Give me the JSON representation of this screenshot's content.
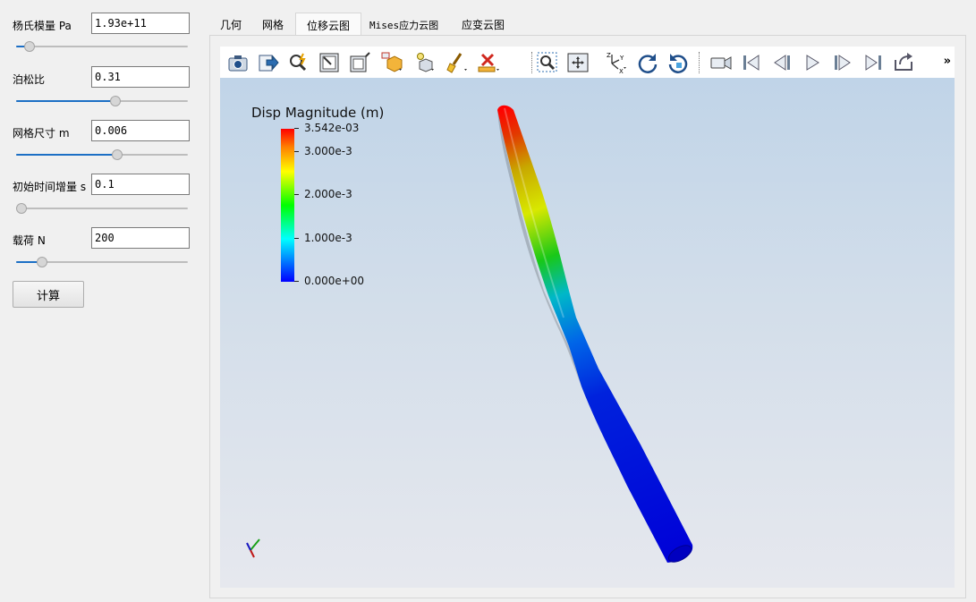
{
  "params": [
    {
      "label": "杨氏模量 Pa",
      "value": "1.93e+11",
      "slider": 0.08
    },
    {
      "label": "泊松比",
      "value": "0.31",
      "slider": 0.58
    },
    {
      "label": "网格尺寸 m",
      "value": "0.006",
      "slider": 0.59
    },
    {
      "label": "初始时间增量 s",
      "value": "0.1",
      "slider": 0.0
    },
    {
      "label": "载荷 N",
      "value": "200",
      "slider": 0.15
    }
  ],
  "calc_button": "计算",
  "tabs": [
    "几何",
    "网格",
    "位移云图",
    "Mises应力云图",
    "应变云图"
  ],
  "active_tab": 2,
  "toolbar_icons": [
    "camera-icon",
    "export-icon",
    "find-data-icon",
    "select-cells-icon",
    "select-points-icon",
    "interactive-select-icon",
    "select-block-icon",
    "brush-icon",
    "clear-selection-icon",
    "zoom-to-box-icon",
    "reset-camera-icon",
    "orientation-axes-icon",
    "rotate-cw-icon",
    "rotate-ccw-icon",
    "camera-record-icon",
    "first-frame-icon",
    "previous-frame-icon",
    "play-icon",
    "next-frame-icon",
    "last-frame-icon",
    "loop-icon"
  ],
  "more_glyph": "»",
  "legend": {
    "title": "Disp Magnitude (m)",
    "ticks": [
      {
        "label": "3.542e-03",
        "frac": 0.0
      },
      {
        "label": "3.000e-3",
        "frac": 0.153
      },
      {
        "label": "2.000e-3",
        "frac": 0.435
      },
      {
        "label": "1.000e-3",
        "frac": 0.718
      },
      {
        "label": "0.000e+00",
        "frac": 1.0
      }
    ]
  },
  "colors": {
    "accent": "#1c6fc5",
    "viewport_top": "#c0d4e8",
    "viewport_bottom": "#e6e8ee"
  }
}
